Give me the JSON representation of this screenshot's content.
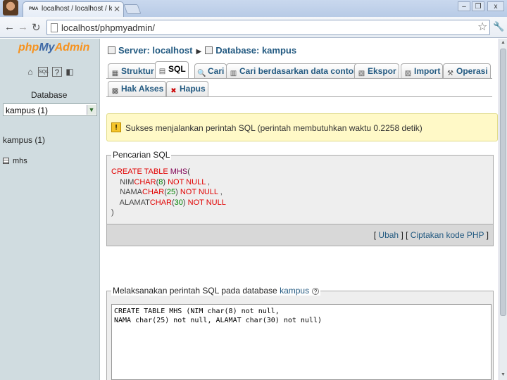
{
  "browser": {
    "tab_title": "localhost / localhost / kampus",
    "tab_favicon": "PMA",
    "url": "localhost/phpmyadmin/",
    "minimize": "–",
    "restore": "❐",
    "close": "x"
  },
  "sidebar": {
    "logo_php": "php",
    "logo_my": "My",
    "logo_admin": "Admin",
    "db_label": "Database",
    "db_selected": "kampus (1)",
    "db_current": "kampus (1)",
    "tables": [
      "mhs"
    ]
  },
  "breadcrumb": {
    "server": "Server: localhost",
    "database": "Database: kampus"
  },
  "tabs": [
    {
      "label": "Struktur",
      "icon": "structure-icon"
    },
    {
      "label": "SQL",
      "icon": "sql-icon",
      "active": true
    },
    {
      "label": "Cari",
      "icon": "search-icon"
    },
    {
      "label": "Cari berdasarkan data contoh",
      "icon": "query-icon"
    },
    {
      "label": "Ekspor",
      "icon": "export-icon"
    },
    {
      "label": "Import",
      "icon": "import-icon"
    },
    {
      "label": "Operasi",
      "icon": "operations-icon"
    },
    {
      "label": "Hak Akses",
      "icon": "privileges-icon"
    },
    {
      "label": "Hapus",
      "icon": "drop-icon"
    }
  ],
  "notice": {
    "text": "Sukses menjalankan perintah SQL (perintah membutuhkan waktu 0.2258 detik)"
  },
  "sql_query_box": {
    "legend": "Pencarian SQL",
    "links_open": "[",
    "edit": "Ubah",
    "sep": "] [",
    "create_php": "Ciptakan kode PHP",
    "links_close": "]"
  },
  "run_sql": {
    "legend_prefix": "Melaksanakan perintah SQL pada database",
    "database": "kampus",
    "query_text": "CREATE TABLE MHS (NIM char(8) not null,\nNAMA char(25) not null, ALAMAT char(30) not null)"
  },
  "colors": {
    "link": "#235a81",
    "keyword": "#e10000",
    "notice_bg": "#fff9c7"
  }
}
